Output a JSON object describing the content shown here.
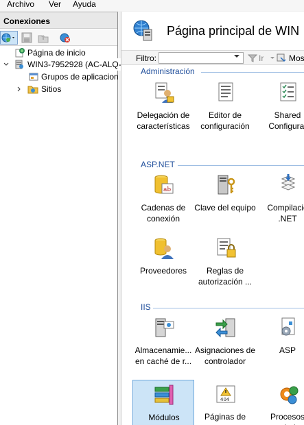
{
  "menu": {
    "items": [
      "Archivo",
      "Ver",
      "Ayuda"
    ]
  },
  "connections": {
    "title": "Conexiones",
    "tree": [
      {
        "label": "Página de inicio"
      },
      {
        "label": "WIN3-7952928 (AC-ALQ-"
      },
      {
        "label": "Grupos de aplicacion"
      },
      {
        "label": "Sitios"
      }
    ]
  },
  "page": {
    "title": "Página principal de WIN",
    "filter_label": "Filtro:",
    "filter_value": "",
    "go_label": "Ir",
    "show_label": "Mos"
  },
  "groups": [
    {
      "name": "Administración",
      "tiles": [
        {
          "label": "Delegación de características",
          "icon": "feature-delegation-icon"
        },
        {
          "label": "Editor de configuración",
          "icon": "configuration-editor-icon"
        },
        {
          "label": "Shared Configurat",
          "icon": "shared-configuration-icon"
        }
      ]
    },
    {
      "name": "ASP.NET",
      "tiles": [
        {
          "label": "Cadenas de conexión",
          "icon": "connection-strings-icon"
        },
        {
          "label": "Clave del equipo",
          "icon": "machine-key-icon"
        },
        {
          "label": "Compilació .NET",
          "icon": "compilation-icon"
        },
        {
          "label": "Proveedores",
          "icon": "providers-icon"
        },
        {
          "label": "Reglas de autorización ...",
          "icon": "authorization-rules-icon"
        }
      ]
    },
    {
      "name": "IIS",
      "tiles": [
        {
          "label": "Almacenamie... en caché de r...",
          "icon": "output-caching-icon"
        },
        {
          "label": "Asignaciones de controlador",
          "icon": "handler-mappings-icon"
        },
        {
          "label": "ASP",
          "icon": "asp-icon"
        },
        {
          "label": "Módulos",
          "icon": "modules-icon",
          "selected": true
        },
        {
          "label": "Páginas de errores",
          "icon": "error-pages-icon"
        },
        {
          "label": "Procesos trabajo",
          "icon": "worker-processes-icon"
        }
      ]
    }
  ]
}
